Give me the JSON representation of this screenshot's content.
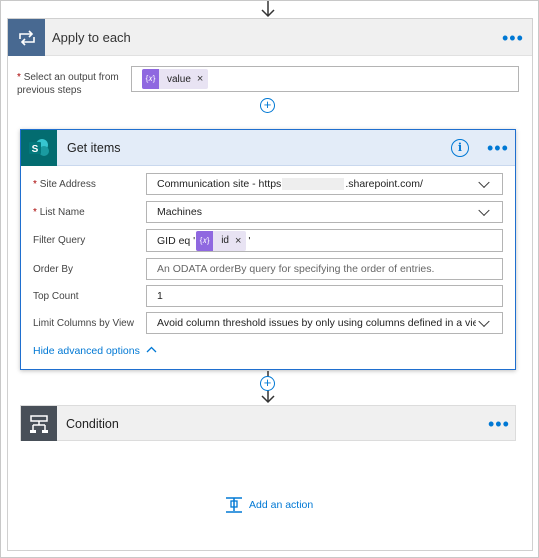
{
  "apply_to_each": {
    "title": "Apply to each",
    "field_label_required": "*",
    "field_label": "Select an output from previous steps",
    "token_value": "value",
    "token_remove": "×"
  },
  "get_items": {
    "title": "Get items",
    "fields": {
      "site_address": {
        "label": "Site Address",
        "required": "*",
        "value": "Communication site - https",
        "value_suffix": ".sharepoint.com/"
      },
      "list_name": {
        "label": "List Name",
        "required": "*",
        "value": "Machines"
      },
      "filter_query": {
        "label": "Filter Query",
        "prefix": "GID eq '",
        "token": "id",
        "token_remove": "×",
        "suffix": "'"
      },
      "order_by": {
        "label": "Order By",
        "placeholder": "An ODATA orderBy query for specifying the order of entries."
      },
      "top_count": {
        "label": "Top Count",
        "value": "1"
      },
      "limit_columns": {
        "label": "Limit Columns by View",
        "value": "Avoid column threshold issues by only using columns defined in a view"
      }
    },
    "hide_advanced": "Hide advanced options"
  },
  "condition": {
    "title": "Condition"
  },
  "add_action": "Add an action",
  "more_menu": "•••",
  "plus": "+",
  "colors": {
    "accent": "#0078d4",
    "scope_icon": "#486991",
    "sharepoint": "#036c70",
    "condition_icon": "#484f58",
    "token": "#8f68e0"
  },
  "icons": {
    "scope": "loop-icon",
    "sharepoint": "sharepoint-icon",
    "condition": "condition-icon",
    "info": "info-icon",
    "dynamic_content": "dynamic-content-icon"
  }
}
